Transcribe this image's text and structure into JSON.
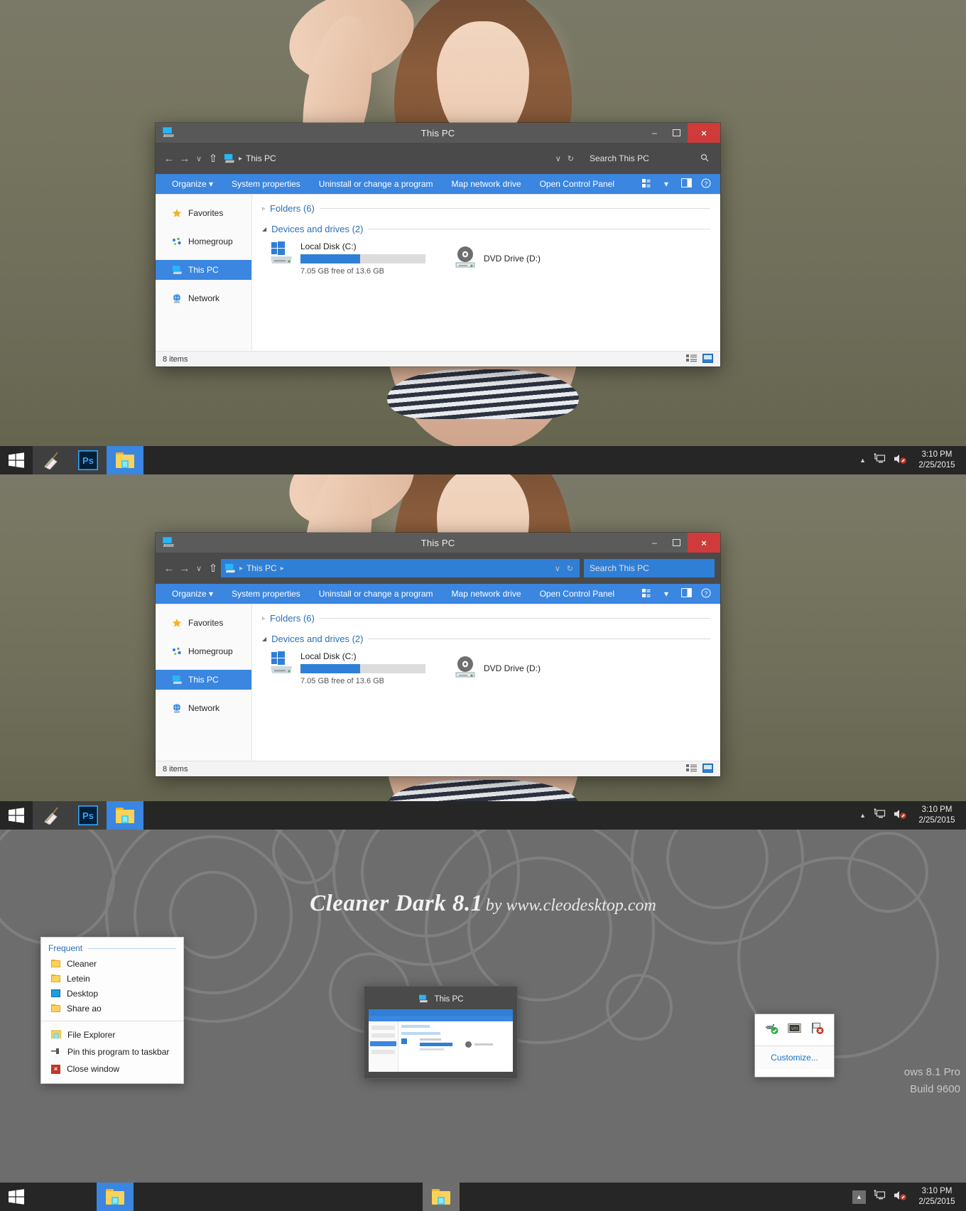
{
  "theme": {
    "name": "Cleaner Dark 8.1",
    "by": "by www.cleodesktop.com",
    "accent": "#3a86e0",
    "titlebar": "#585858",
    "taskbar": "#262626",
    "close_red": "#cf3b3b"
  },
  "explorer": {
    "title": "This PC",
    "window_icon": "this-pc-icon",
    "buttons": {
      "minimize": "–",
      "maximize": "❐",
      "close": "×"
    },
    "address": {
      "back": "←",
      "forward": "→",
      "recent": "∨",
      "up": "⇧",
      "crumb_icon": "this-pc-icon",
      "crumb": "This PC",
      "sep": "▸",
      "dropdown": "∨",
      "refresh": "↻"
    },
    "search": {
      "placeholder": "Search This PC",
      "icon": "search-icon"
    },
    "commands": [
      "Organize",
      "System properties",
      "Uninstall or change a program",
      "Map network drive",
      "Open Control Panel"
    ],
    "organize_caret": "▾",
    "command_icons": [
      "layout-icon",
      "caret-down-icon",
      "preview-pane-icon",
      "help-icon"
    ],
    "nav_pane": [
      {
        "label": "Favorites",
        "icon": "star-icon",
        "selected": false
      },
      {
        "label": "Homegroup",
        "icon": "homegroup-icon",
        "selected": false
      },
      {
        "label": "This PC",
        "icon": "this-pc-icon",
        "selected": true
      },
      {
        "label": "Network",
        "icon": "network-icon",
        "selected": false
      }
    ],
    "groups": [
      {
        "label": "Folders (6)",
        "expanded": false,
        "marker": "▹"
      },
      {
        "label": "Devices and drives (2)",
        "expanded": true,
        "marker": "◢"
      }
    ],
    "drives": [
      {
        "name": "Local Disk (C:)",
        "icon": "windows-disk-icon",
        "free": "7.05 GB free of 13.6 GB",
        "used_percent": 48
      },
      {
        "name": "DVD Drive (D:)",
        "icon": "dvd-drive-icon",
        "free": "",
        "used_percent": 0
      }
    ],
    "status": {
      "items": "8 items",
      "view_icons": [
        "details-view-icon",
        "large-icons-view-icon"
      ]
    }
  },
  "taskbar": {
    "start_icon": "windows-start-icon",
    "buttons": [
      {
        "name": "broom-app",
        "icon": "broom-icon",
        "state": "alt"
      },
      {
        "name": "photoshop",
        "icon": "photoshop-icon",
        "state": "alt"
      },
      {
        "name": "file-explorer",
        "icon": "folder-icon",
        "state": "active"
      }
    ],
    "tray": {
      "show_hidden": "▲",
      "network_icon": "network-tray-icon",
      "volume_icon": "volume-muted-icon"
    },
    "clock": {
      "time": "3:10 PM",
      "date": "2/25/2015"
    }
  },
  "taskbar_bottom": {
    "start_icon": "windows-start-icon",
    "buttons": [
      {
        "name": "file-explorer",
        "icon": "folder-icon",
        "state": "active"
      }
    ],
    "tray": {
      "show_hidden": "▲",
      "network_icon": "network-tray-icon",
      "volume_icon": "volume-muted-icon"
    },
    "clock": {
      "time": "3:10 PM",
      "date": "2/25/2015"
    }
  },
  "jumplist": {
    "header": "Frequent",
    "frequent": [
      {
        "label": "Cleaner",
        "icon": "folder-icon"
      },
      {
        "label": "Letein",
        "icon": "folder-icon"
      },
      {
        "label": "Desktop",
        "icon": "desktop-icon"
      },
      {
        "label": "Share ao",
        "icon": "folder-icon"
      }
    ],
    "actions": [
      {
        "label": "File Explorer",
        "icon": "file-explorer-icon"
      },
      {
        "label": "Pin this program to taskbar",
        "icon": "pin-icon"
      },
      {
        "label": "Close window",
        "icon": "close-x-icon"
      }
    ]
  },
  "thumbnail": {
    "caption": "This PC",
    "icon": "this-pc-icon"
  },
  "tray_popup": {
    "icons": [
      "usb-safely-remove-icon",
      "vm-icon",
      "flag-error-icon"
    ],
    "customize": "Customize..."
  },
  "watermark": {
    "line1": "ows 8.1 Pro",
    "line2": "Build 9600"
  }
}
